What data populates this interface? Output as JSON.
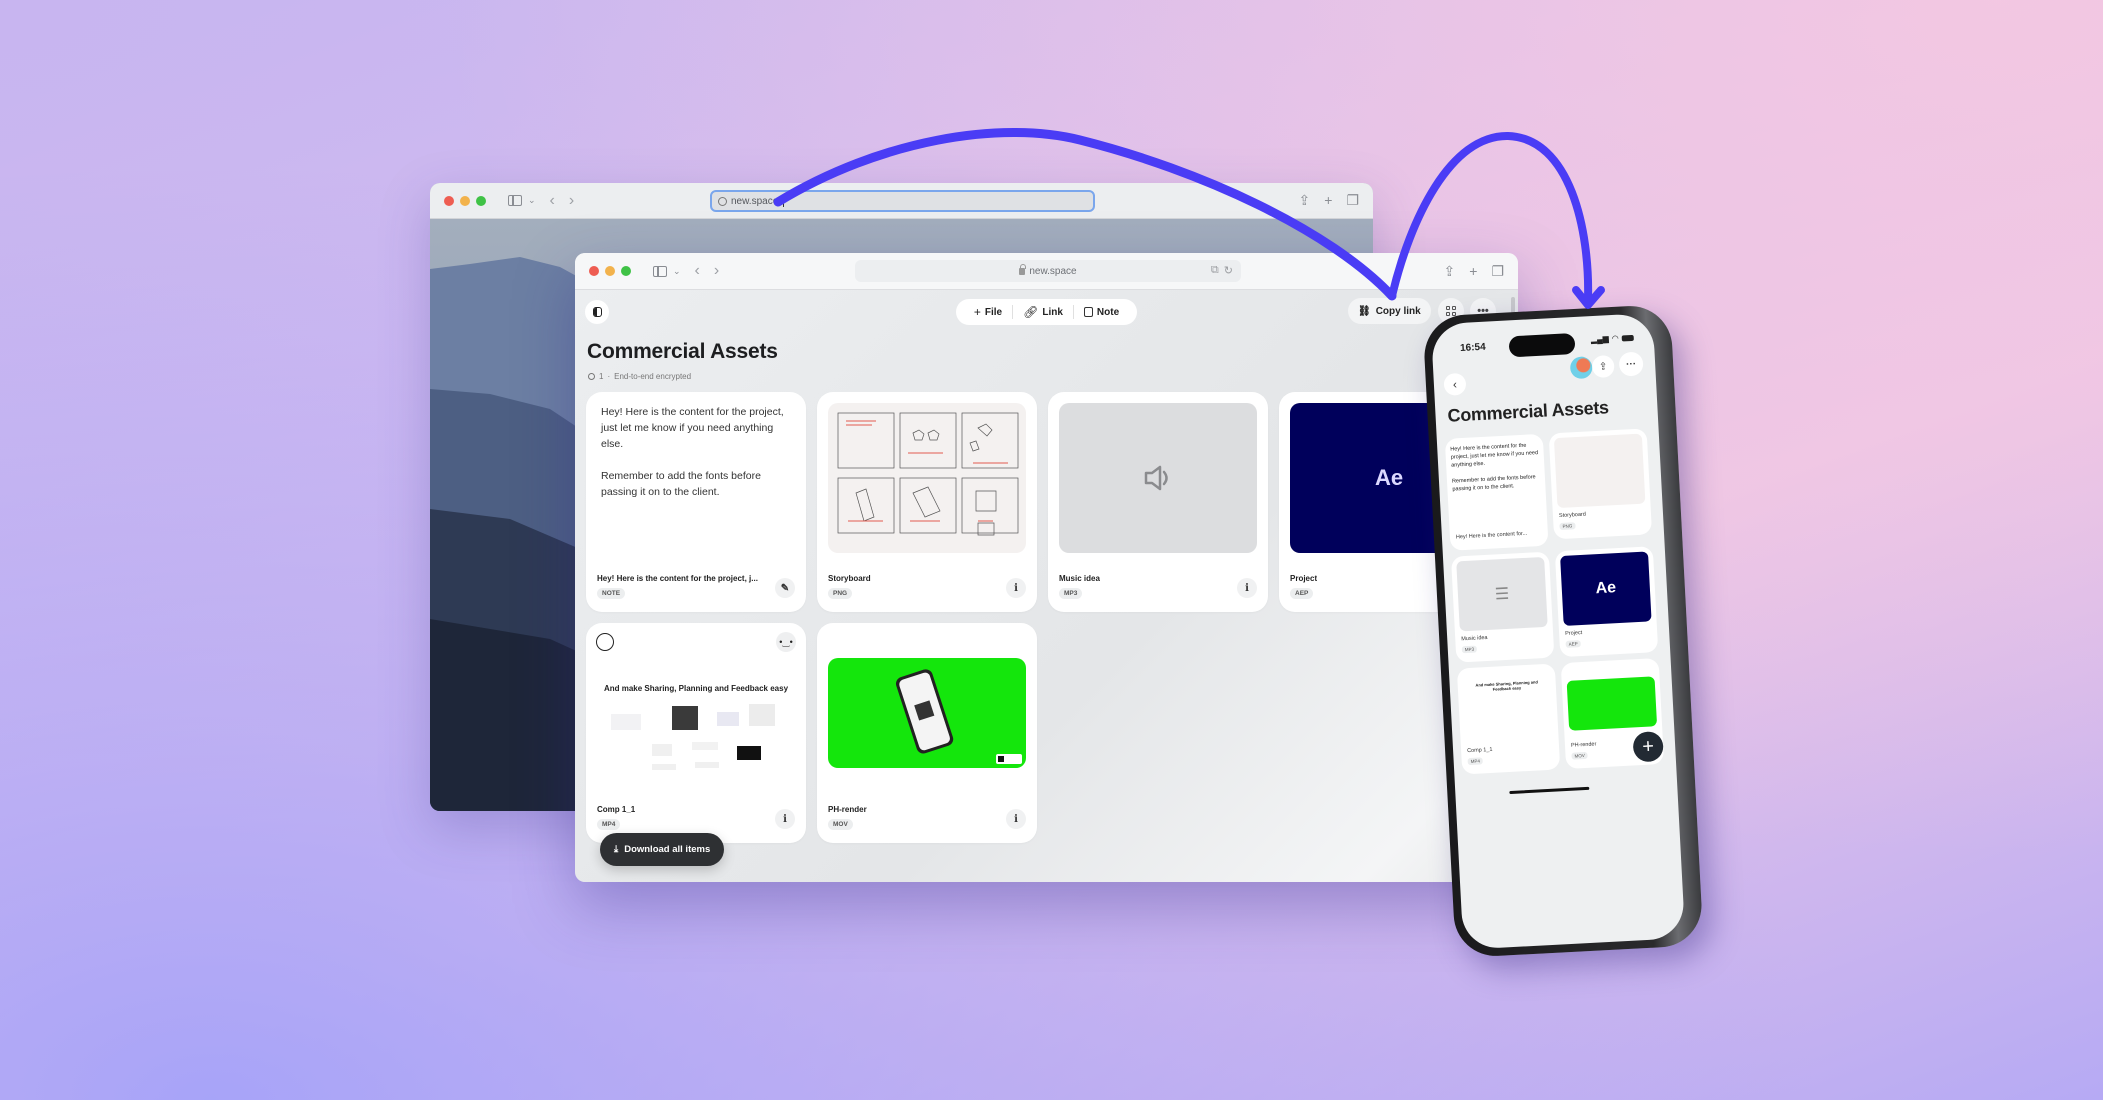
{
  "colors": {
    "arrow": "#4a3cf5",
    "ae_bg": "#00005b",
    "green_screen": "#14e60c",
    "download_button": "#2e3033"
  },
  "back_window": {
    "url": "new.space",
    "icons": [
      "sidebar-icon",
      "chevron-down-icon",
      "back-icon",
      "forward-icon",
      "share-icon",
      "new-tab-icon",
      "tabs-icon"
    ]
  },
  "front_window": {
    "url": "new.space",
    "toolbar": {
      "file_label": "File",
      "link_label": "Link",
      "note_label": "Note",
      "copy_link_label": "Copy link"
    },
    "page": {
      "title": "Commercial Assets",
      "members": "1",
      "separator": "·",
      "encryption": "End-to-end encrypted"
    },
    "cards": [
      {
        "type": "note",
        "body": [
          "Hey! Here is the content for the project, just let me know if you need anything else.",
          "Remember to add the fonts before passing it on to the client."
        ],
        "name": "Hey! Here is the content for the project, j...",
        "tag": "NOTE"
      },
      {
        "type": "image",
        "name": "Storyboard",
        "tag": "PNG"
      },
      {
        "type": "audio",
        "name": "Music idea",
        "tag": "MP3"
      },
      {
        "type": "project",
        "thumb_text": "Ae",
        "name": "Project",
        "tag": "AEP"
      },
      {
        "type": "video",
        "thumb_text": "And make Sharing, Planning and Feedback easy",
        "name": "Comp 1_1",
        "tag": "MP4"
      },
      {
        "type": "video",
        "name": "PH-render",
        "tag": "MOV"
      }
    ],
    "download_label": "Download all items"
  },
  "phone": {
    "time": "16:54",
    "title": "Commercial Assets",
    "note_body": [
      "Hey! Here is the content for the project, just let me know if you need anything else.",
      "Remember to add the fonts before passing it on to the client."
    ],
    "cards": [
      {
        "name": "Hey! Here is the content for...",
        "tag": ""
      },
      {
        "name": "Storyboard",
        "tag": "PNG"
      },
      {
        "name": "Music idea",
        "tag": "MP3"
      },
      {
        "name": "Project",
        "tag": "AEP",
        "thumb_text": "Ae"
      },
      {
        "name": "Comp 1_1",
        "tag": "MP4",
        "thumb_text": "And make Sharing, Planning and Feedback easy"
      },
      {
        "name": "PH-render",
        "tag": "MOV"
      }
    ]
  }
}
